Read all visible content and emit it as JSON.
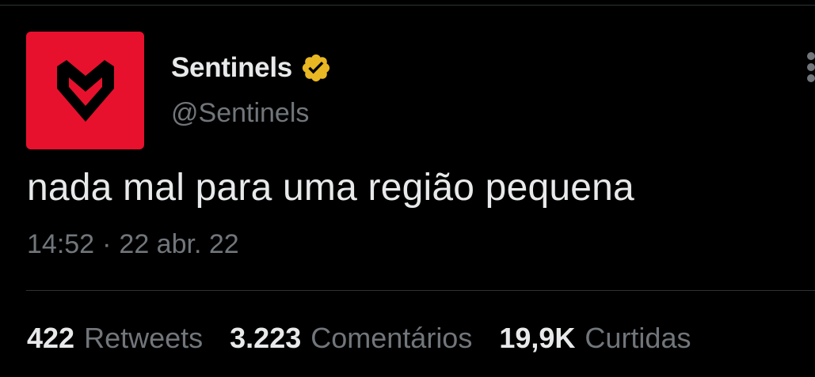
{
  "colors": {
    "background": "#000000",
    "avatar_bg": "#e8112d",
    "text_primary": "#e7e9ea",
    "text_secondary": "#71767b",
    "verified_badge": "#e8b723",
    "divider": "#2f3336"
  },
  "author": {
    "display_name": "Sentinels",
    "handle": "@Sentinels",
    "verified": true,
    "avatar_icon": "sentinels-logo-icon",
    "verified_icon": "verified-badge-icon"
  },
  "tweet": {
    "text": "nada mal para uma região pequena",
    "time": "14:52",
    "separator": "·",
    "date": "22 abr. 22"
  },
  "stats": {
    "retweets": {
      "count": "422",
      "label": "Retweets"
    },
    "comments": {
      "count": "3.223",
      "label": "Comentários"
    },
    "likes": {
      "count": "19,9K",
      "label": "Curtidas"
    }
  },
  "more_icon": "more-options-icon"
}
